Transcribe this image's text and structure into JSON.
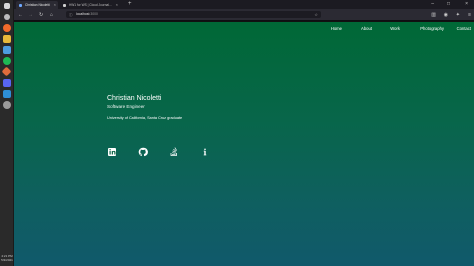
{
  "browser": {
    "tabs": [
      {
        "label": "Christian Nicoletti",
        "active": true
      },
      {
        "label": "HW1 for WS | Cloud Journal...",
        "active": false
      }
    ],
    "url": {
      "host": "localhost",
      "port": ":3000"
    }
  },
  "site": {
    "nav": [
      "Home",
      "About",
      "Work",
      "Photography",
      "Contact"
    ],
    "name": "Christian Nicoletti",
    "role": "Software Engineer",
    "education": "University of California, Santa Cruz graduate",
    "socials": [
      "linkedin-icon",
      "github-icon",
      "stackoverflow-icon",
      "info-icon"
    ]
  },
  "taskbar": {
    "time": "4:21 PM",
    "date": "5/3/2021"
  },
  "colors": {
    "gradient_top": "#006836",
    "gradient_bottom": "#10596b",
    "text": "#ffffff"
  }
}
